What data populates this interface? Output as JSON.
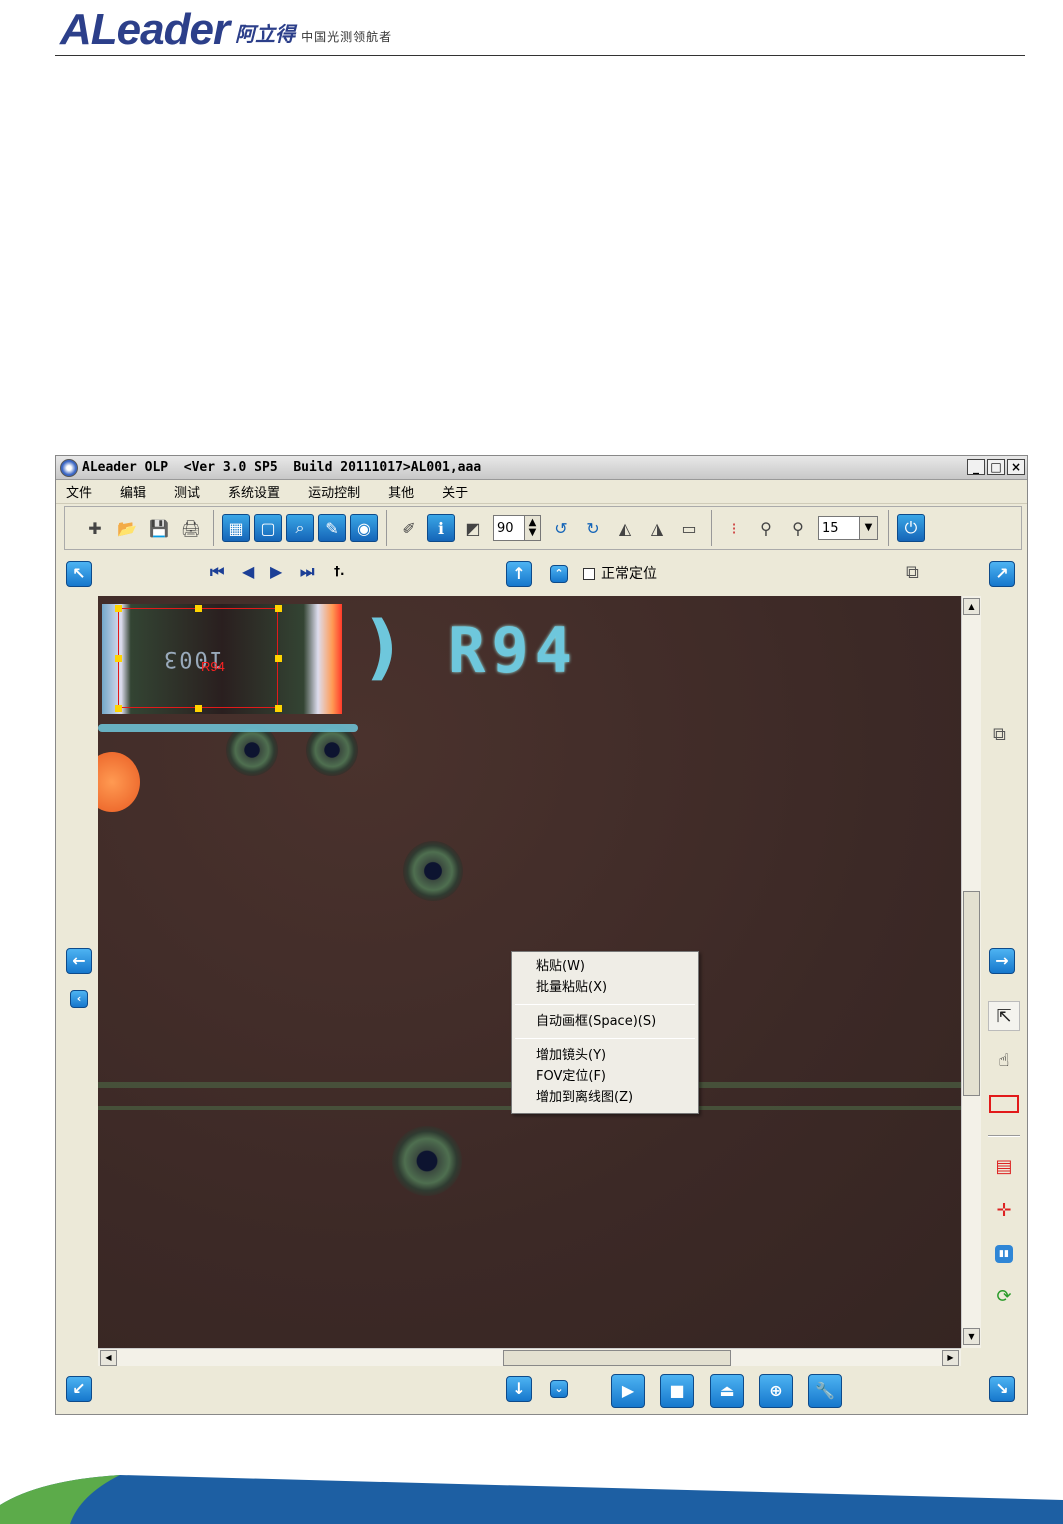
{
  "brand": {
    "logo": "ALeader",
    "logo_cn": "阿立得",
    "tagline": "中国光测领航者"
  },
  "window": {
    "title": "ALeader OLP  <Ver 3.0 SP5  Build 20111017>AL001,aaa",
    "controls": {
      "minimize": "_",
      "maximize": "□",
      "close": "×"
    }
  },
  "menu": [
    "文件",
    "编辑",
    "测试",
    "系统设置",
    "运动控制",
    "其他",
    "关于"
  ],
  "toolbar": {
    "rotate_value": "90",
    "zoom_value": "15",
    "icons": [
      "new-file-icon",
      "open-file-icon",
      "save-icon",
      "print-icon",
      "camera-group-icon",
      "frame-icon",
      "magnifier-icon",
      "edit-doc-icon",
      "snapshot-icon",
      "note-icon",
      "info-icon",
      "contrast-icon",
      "rotate-left-icon",
      "rotate-right-icon",
      "mirror-h-icon",
      "mirror-v-icon",
      "rectangle-icon",
      "color-pick-icon",
      "zoom-out-icon",
      "zoom-in-icon",
      "power-icon"
    ]
  },
  "nav": {
    "first": "⏮",
    "prev": "◀",
    "next": "▶",
    "last": "⏭",
    "marker": "†.",
    "normal_locate_label": "正常定位"
  },
  "canvas": {
    "silkscreen_text": "R94",
    "component_marking": "1003",
    "selection_label": "R94"
  },
  "context_menu": {
    "group1": [
      "粘贴(W)",
      "批量粘贴(X)"
    ],
    "group2": [
      "自动画框(Space)(S)"
    ],
    "group3": [
      "增加镜头(Y)",
      "FOV定位(F)",
      "增加到离线图(Z)"
    ]
  },
  "colors": {
    "accent": "#1677cc",
    "brand": "#2c3f8a",
    "selection": "#e21a1a"
  }
}
